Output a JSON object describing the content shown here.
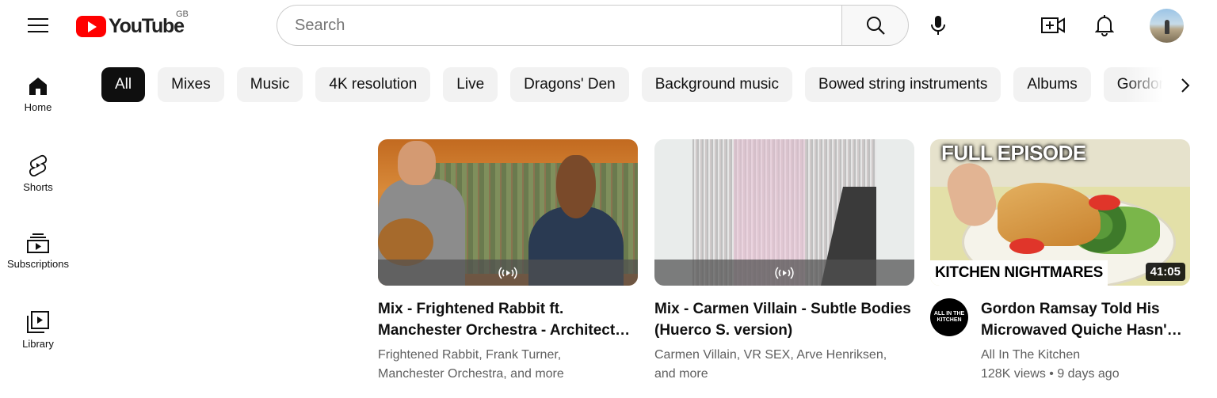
{
  "header": {
    "logo_text": "YouTube",
    "country_code": "GB",
    "search": {
      "placeholder": "Search",
      "value": ""
    }
  },
  "sidebar": {
    "items": [
      {
        "label": "Home",
        "icon": "home-icon"
      },
      {
        "label": "Shorts",
        "icon": "shorts-icon"
      },
      {
        "label": "Subscriptions",
        "icon": "subscriptions-icon"
      },
      {
        "label": "Library",
        "icon": "library-icon"
      }
    ]
  },
  "chips": [
    {
      "label": "All",
      "active": true
    },
    {
      "label": "Mixes"
    },
    {
      "label": "Music"
    },
    {
      "label": "4K resolution"
    },
    {
      "label": "Live"
    },
    {
      "label": "Dragons' Den"
    },
    {
      "label": "Background music"
    },
    {
      "label": "Bowed string instruments"
    },
    {
      "label": "Albums"
    },
    {
      "label": "Gordon Ramsay"
    }
  ],
  "videos": [
    {
      "title": "Mix - Frightened Rabbit ft. Manchester Orchestra - Architect…",
      "line1": "Frightened Rabbit, Frank Turner,",
      "line2": "Manchester Orchestra, and more",
      "is_mix": true
    },
    {
      "title": "Mix - Carmen Villain - Subtle Bodies (Huerco S. version)",
      "line1": "Carmen Villain, VR SEX, Arve Henriksen,",
      "line2": "and more",
      "is_mix": true
    },
    {
      "title": "Gordon Ramsay Told His Microwaved Quiche Hasn'…",
      "channel": "All In The Kitchen",
      "channel_avatar_text": "ALL IN THE KITCHEN",
      "views_date": "128K views • 9 days ago",
      "duration": "41:05",
      "overlay_top": "FULL EPISODE",
      "overlay_bottom": "KITCHEN NIGHTMARES"
    }
  ],
  "colors": {
    "brand_red": "#ff0000",
    "chip_active": "#0f0f0f",
    "chip_bg": "#f2f2f2",
    "secondary_text": "#606060"
  }
}
